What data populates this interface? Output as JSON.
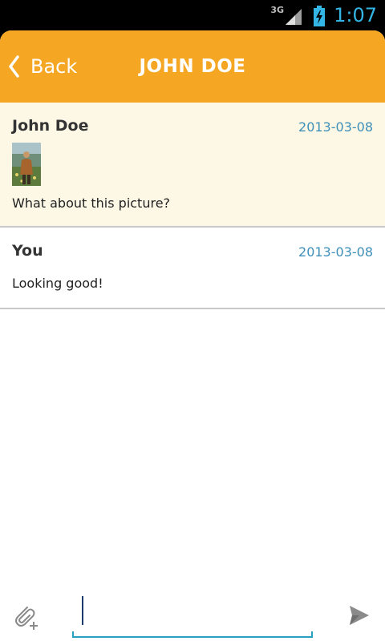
{
  "status_bar": {
    "network": "3G",
    "time": "1:07",
    "icons": [
      "signal-icon",
      "battery-charging-icon"
    ]
  },
  "header": {
    "back_label": "Back",
    "title": "JOHN DOE",
    "accent_color": "#f5a623"
  },
  "messages": [
    {
      "sender": "John Doe",
      "date": "2013-03-08",
      "has_image": true,
      "text": "What about this picture?"
    },
    {
      "sender": "You",
      "date": "2013-03-08",
      "text": "Looking good!"
    }
  ],
  "composer": {
    "input_value": "",
    "icons": [
      "paperclip-add-icon",
      "send-icon"
    ],
    "underline_color": "#2aa0c0"
  }
}
